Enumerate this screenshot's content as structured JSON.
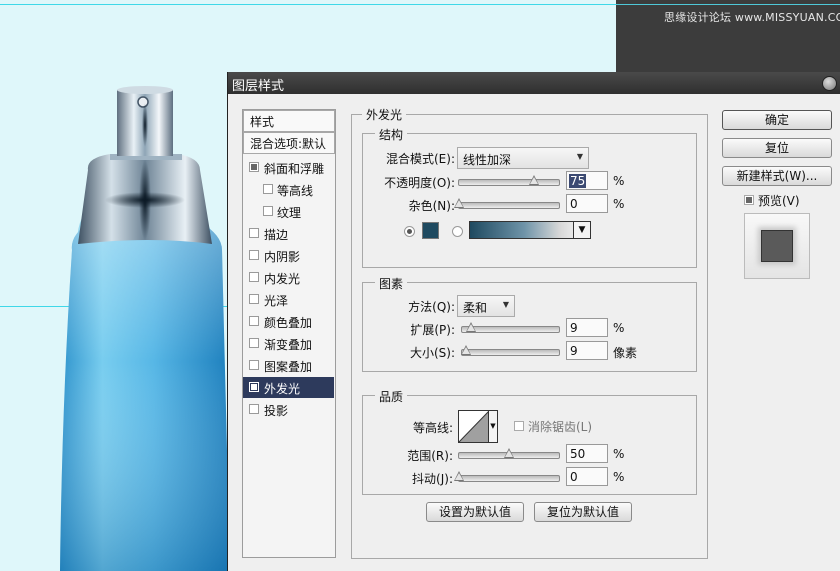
{
  "watermark": "思缘设计论坛 www.MISSYUAN.COM",
  "colors": {
    "canvas": "#dff7fa",
    "guide": "#3fd8e8",
    "selection": "#2d3a5c",
    "glow_swatch": "#1f4a60",
    "bottle_blue": "#3aa8dc"
  },
  "dialog": {
    "title": "图层样式",
    "style_list": {
      "header_styles": "样式",
      "header_blending": "混合选项:默认",
      "items": [
        {
          "label": "斜面和浮雕",
          "checked": true,
          "active": false,
          "indent": false
        },
        {
          "label": "等高线",
          "checked": false,
          "active": false,
          "indent": true
        },
        {
          "label": "纹理",
          "checked": false,
          "active": false,
          "indent": true
        },
        {
          "label": "描边",
          "checked": false,
          "active": false,
          "indent": false
        },
        {
          "label": "内阴影",
          "checked": false,
          "active": false,
          "indent": false
        },
        {
          "label": "内发光",
          "checked": false,
          "active": false,
          "indent": false
        },
        {
          "label": "光泽",
          "checked": false,
          "active": false,
          "indent": false
        },
        {
          "label": "颜色叠加",
          "checked": false,
          "active": false,
          "indent": false
        },
        {
          "label": "渐变叠加",
          "checked": false,
          "active": false,
          "indent": false
        },
        {
          "label": "图案叠加",
          "checked": false,
          "active": false,
          "indent": false
        },
        {
          "label": "外发光",
          "checked": true,
          "active": true,
          "indent": false
        },
        {
          "label": "投影",
          "checked": false,
          "active": false,
          "indent": false
        }
      ]
    },
    "outer_glow": {
      "title": "外发光",
      "structure": {
        "title": "结构",
        "blend_mode_label": "混合模式(E):",
        "blend_mode_value": "线性加深",
        "opacity_label": "不透明度(O):",
        "opacity_value": "75",
        "opacity_fraction": 0.75,
        "noise_label": "杂色(N):",
        "noise_value": "0",
        "noise_fraction": 0,
        "percent": "%"
      },
      "elements": {
        "title": "图素",
        "technique_label": "方法(Q):",
        "technique_value": "柔和",
        "spread_label": "扩展(P):",
        "spread_value": "9",
        "spread_fraction": 0.09,
        "size_label": "大小(S):",
        "size_value": "9",
        "size_fraction": 0.037,
        "percent": "%",
        "pixels": "像素"
      },
      "quality": {
        "title": "品质",
        "contour_label": "等高线:",
        "anti_alias_label": "消除锯齿(L)",
        "anti_alias_checked": false,
        "range_label": "范围(R):",
        "range_value": "50",
        "range_fraction": 0.5,
        "jitter_label": "抖动(J):",
        "jitter_value": "0",
        "jitter_fraction": 0,
        "percent": "%"
      },
      "make_default": "设置为默认值",
      "reset_default": "复位为默认值"
    },
    "buttons": {
      "ok": "确定",
      "reset": "复位",
      "new_style": "新建样式(W)...",
      "preview_label": "预览(V)",
      "preview_checked": true
    }
  }
}
